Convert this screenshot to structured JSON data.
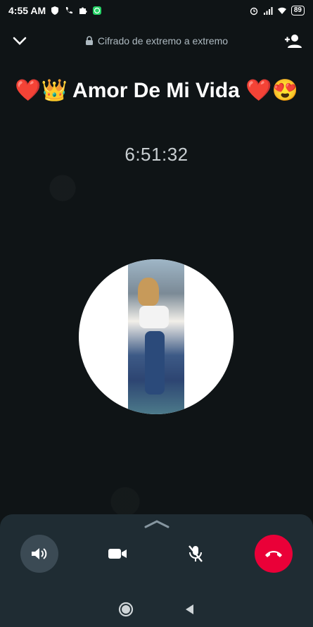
{
  "status_bar": {
    "time": "4:55 AM",
    "battery": "89"
  },
  "header": {
    "encryption_text": "Cifrado de extremo a extremo"
  },
  "call": {
    "caller_name": "❤️👑 Amor De Mi Vida ❤️😍",
    "duration": "6:51:32"
  },
  "controls": {
    "icons": [
      "speaker-icon",
      "video-icon",
      "mic-off-icon",
      "end-call-icon"
    ]
  },
  "colors": {
    "background": "#0f1416",
    "panel": "#1f2c33",
    "end_call": "#ea0038",
    "speaker_active": "#3b4a54"
  }
}
